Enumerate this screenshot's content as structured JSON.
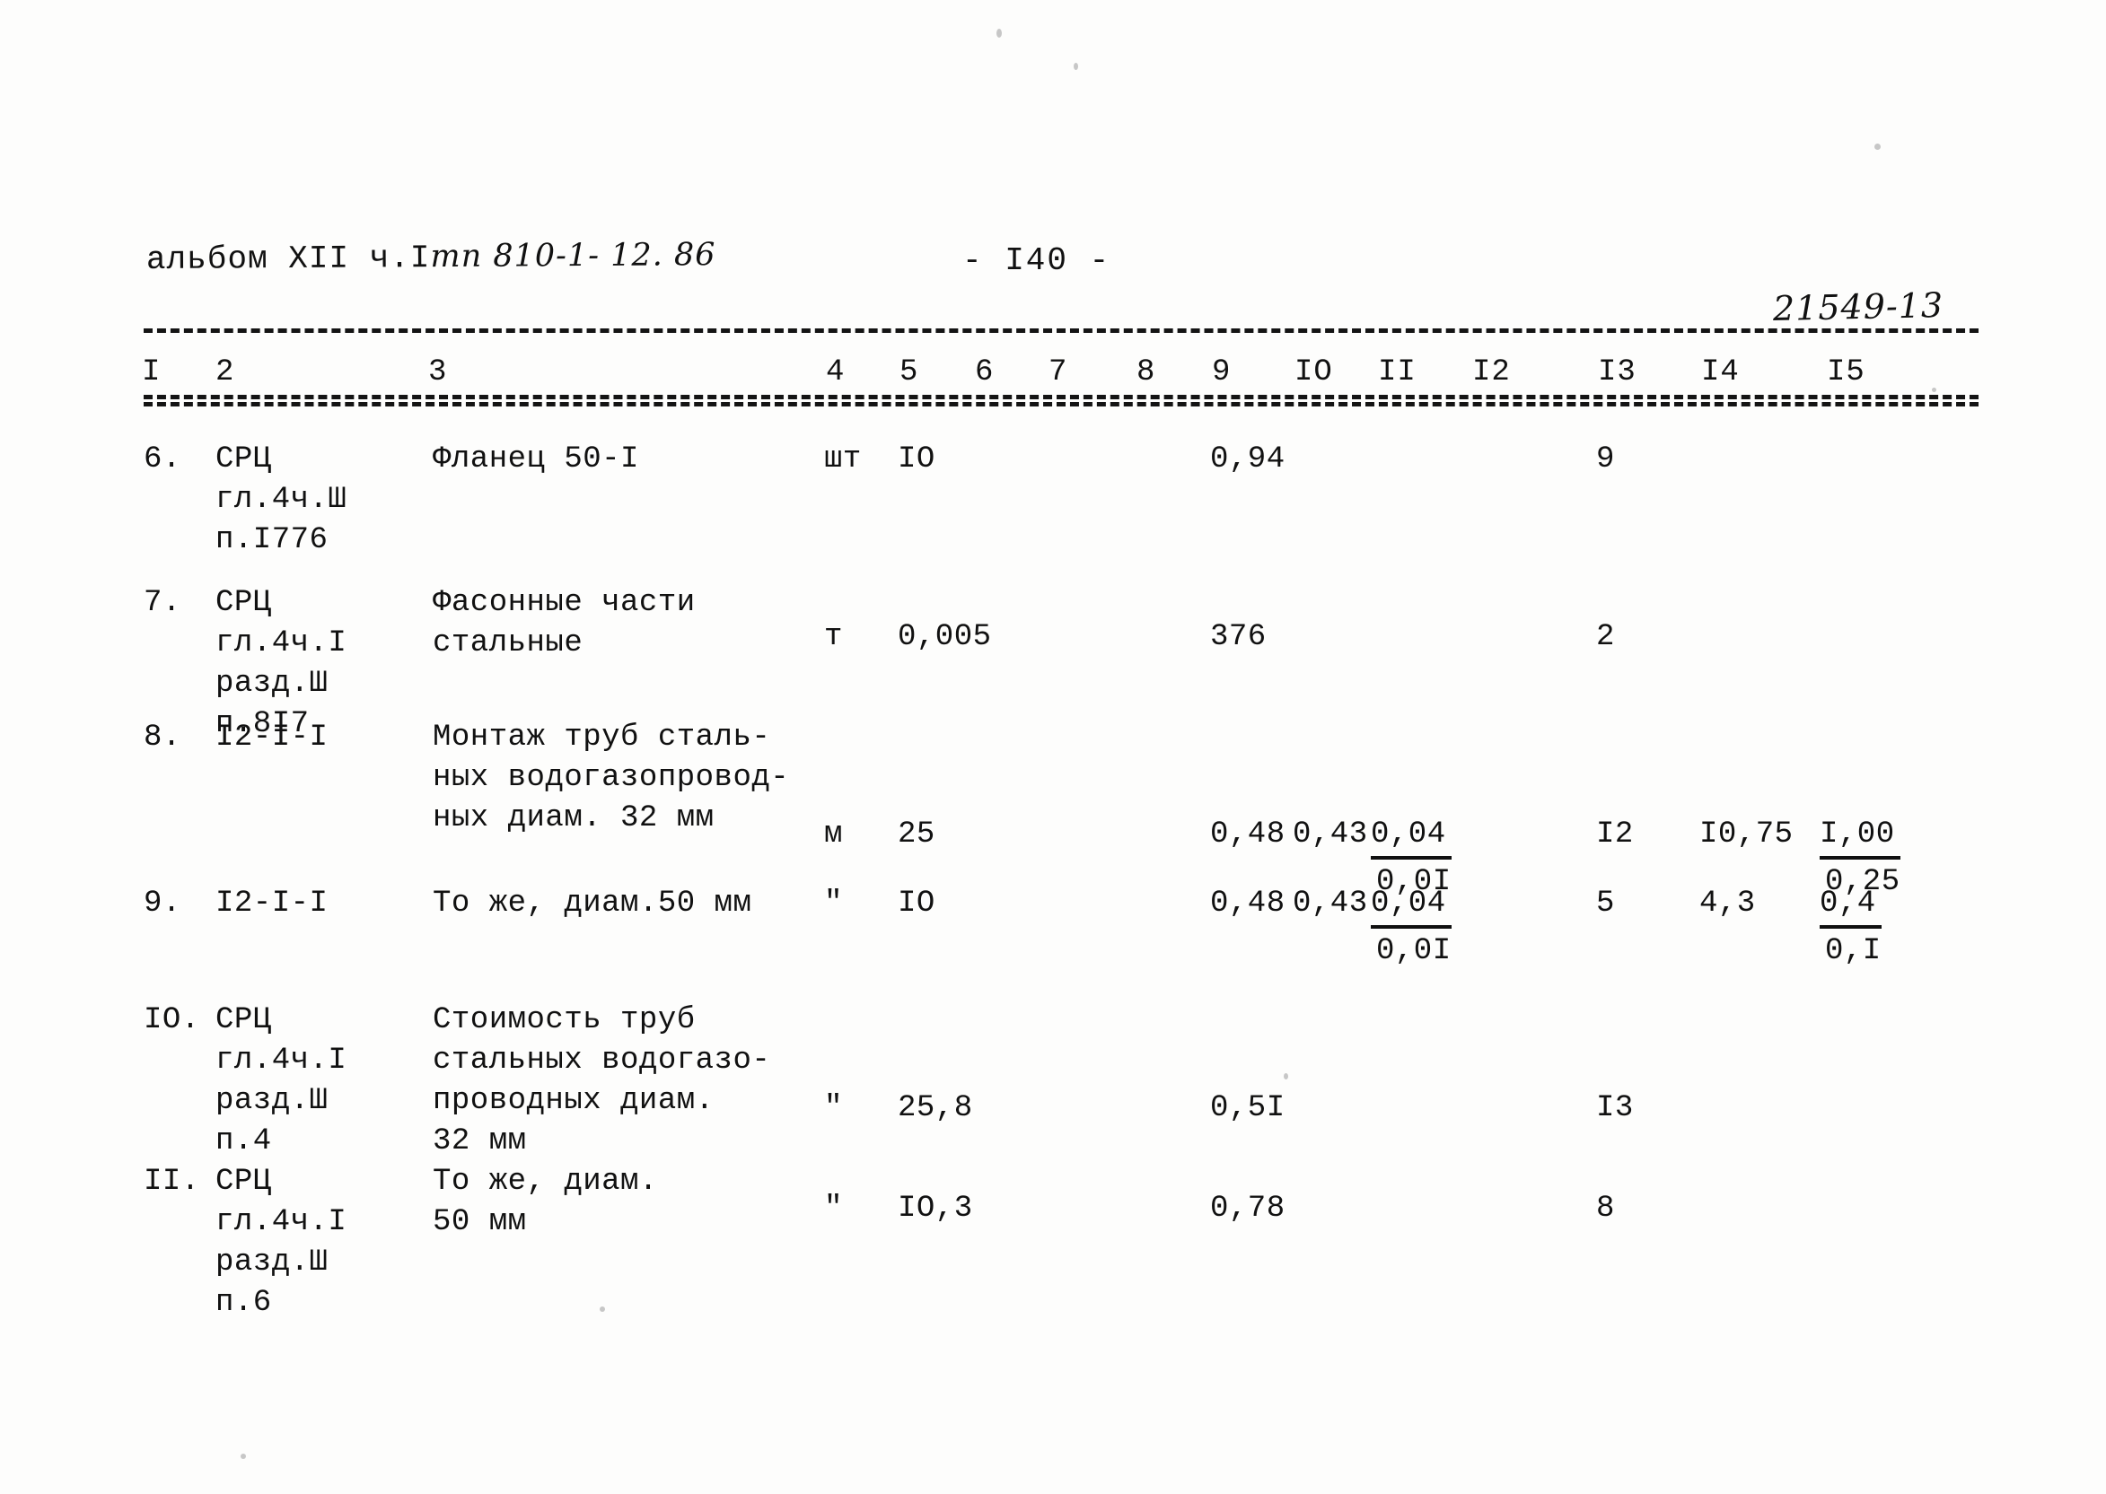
{
  "header": {
    "album_prefix": "альбом XII ч.I",
    "album_code": "тп 810-1- 12. 86",
    "page_number": "- I40 -",
    "doc_code": "21549-13"
  },
  "table": {
    "column_headers": [
      "I",
      "2",
      "3",
      "4",
      "5",
      "6",
      "7",
      "8",
      "9",
      "IO",
      "II",
      "I2",
      "I3",
      "I4",
      "I5"
    ],
    "rows": [
      {
        "no": "6.",
        "code": [
          "СРЦ",
          "гл.4ч.Ш",
          "п.I776"
        ],
        "desc": [
          "Фланец 50-I"
        ],
        "unit": "шт",
        "c5": "IO",
        "c6": "",
        "c7": "",
        "c8": "",
        "c9": "0,94",
        "c10": "",
        "c11_top": "",
        "c11_bot": "",
        "c12": "",
        "c13": "9",
        "c14": "",
        "c15_top": "",
        "c15_bot": ""
      },
      {
        "no": "7.",
        "code": [
          "СРЦ",
          "гл.4ч.I",
          "разд.Ш",
          "п.8I7"
        ],
        "desc": [
          "Фасонные части",
          "стальные"
        ],
        "unit": "т",
        "c5": "0,005",
        "c6": "",
        "c7": "",
        "c8": "",
        "c9": "376",
        "c10": "",
        "c11_top": "",
        "c11_bot": "",
        "c12": "",
        "c13": "2",
        "c14": "",
        "c15_top": "",
        "c15_bot": ""
      },
      {
        "no": "8.",
        "code": [
          "I2-I-I"
        ],
        "desc": [
          "Монтаж труб сталь-",
          "ных водогазопровод-",
          "ных диам. 32 мм"
        ],
        "unit": "м",
        "c5": "25",
        "c6": "",
        "c7": "",
        "c8": "",
        "c9": "0,48",
        "c10": "0,43",
        "c11_top": "0,04",
        "c11_bot": "0,0I",
        "c12": "",
        "c13": "I2",
        "c14": "I0,75",
        "c15_top": "I,00",
        "c15_bot": "0,25"
      },
      {
        "no": "9.",
        "code": [
          "I2-I-I"
        ],
        "desc": [
          "То же, диам.50 мм"
        ],
        "unit": "\"",
        "c5": "IO",
        "c6": "",
        "c7": "",
        "c8": "",
        "c9": "0,48",
        "c10": "0,43",
        "c11_top": "0,04",
        "c11_bot": "0,0I",
        "c12": "",
        "c13": "5",
        "c14": "4,3",
        "c15_top": "0,4",
        "c15_bot": "0,I"
      },
      {
        "no": "IO.",
        "code": [
          "СРЦ",
          "гл.4ч.I",
          "разд.Ш",
          "п.4"
        ],
        "desc": [
          "Стоимость труб",
          "стальных водогазо-",
          "проводных диам.",
          "32 мм"
        ],
        "unit": "\"",
        "c5": "25,8",
        "c6": "",
        "c7": "",
        "c8": "",
        "c9": "0,5I",
        "c10": "",
        "c11_top": "",
        "c11_bot": "",
        "c12": "",
        "c13": "I3",
        "c14": "",
        "c15_top": "",
        "c15_bot": ""
      },
      {
        "no": "II.",
        "code": [
          "СРЦ",
          "гл.4ч.I",
          "разд.Ш",
          "п.6"
        ],
        "desc": [
          "То же, диам.",
          "50 мм"
        ],
        "unit": "\"",
        "c5": "IO,3",
        "c6": "",
        "c7": "",
        "c8": "",
        "c9": "0,78",
        "c10": "",
        "c11_top": "",
        "c11_bot": "",
        "c12": "",
        "c13": "8",
        "c14": "",
        "c15_top": "",
        "c15_bot": ""
      }
    ]
  }
}
